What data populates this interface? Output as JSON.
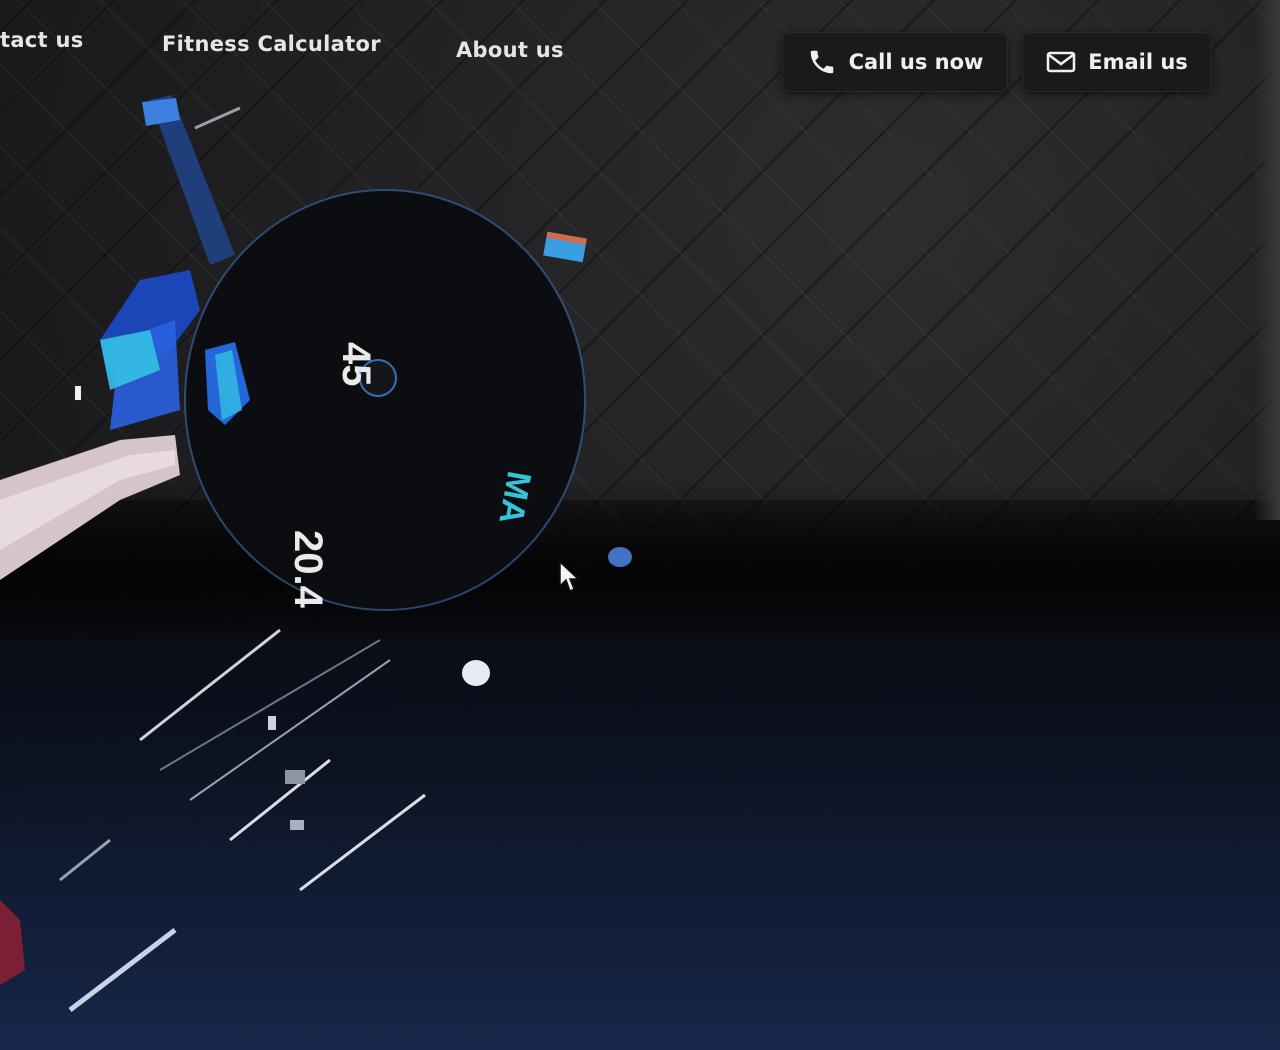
{
  "nav": {
    "items": [
      {
        "label": "tact us"
      },
      {
        "label": "Fitness Calculator"
      },
      {
        "label": "About us"
      }
    ]
  },
  "cta": {
    "call_label": "Call us now",
    "email_label": "Email us"
  },
  "hero": {
    "plate": {
      "weight_lb": "45",
      "weight_kg": "20.4",
      "brand": "MA"
    }
  },
  "colors": {
    "accent": "#37c3d8",
    "nav_text": "#e6e6e6",
    "button_bg": "#1a1a1b",
    "page_dark": "#1e1e20",
    "page_bottom": "#16274a"
  },
  "icons": {
    "call": "phone-icon",
    "email": "envelope-icon",
    "pointer": "mouse-cursor-icon"
  }
}
